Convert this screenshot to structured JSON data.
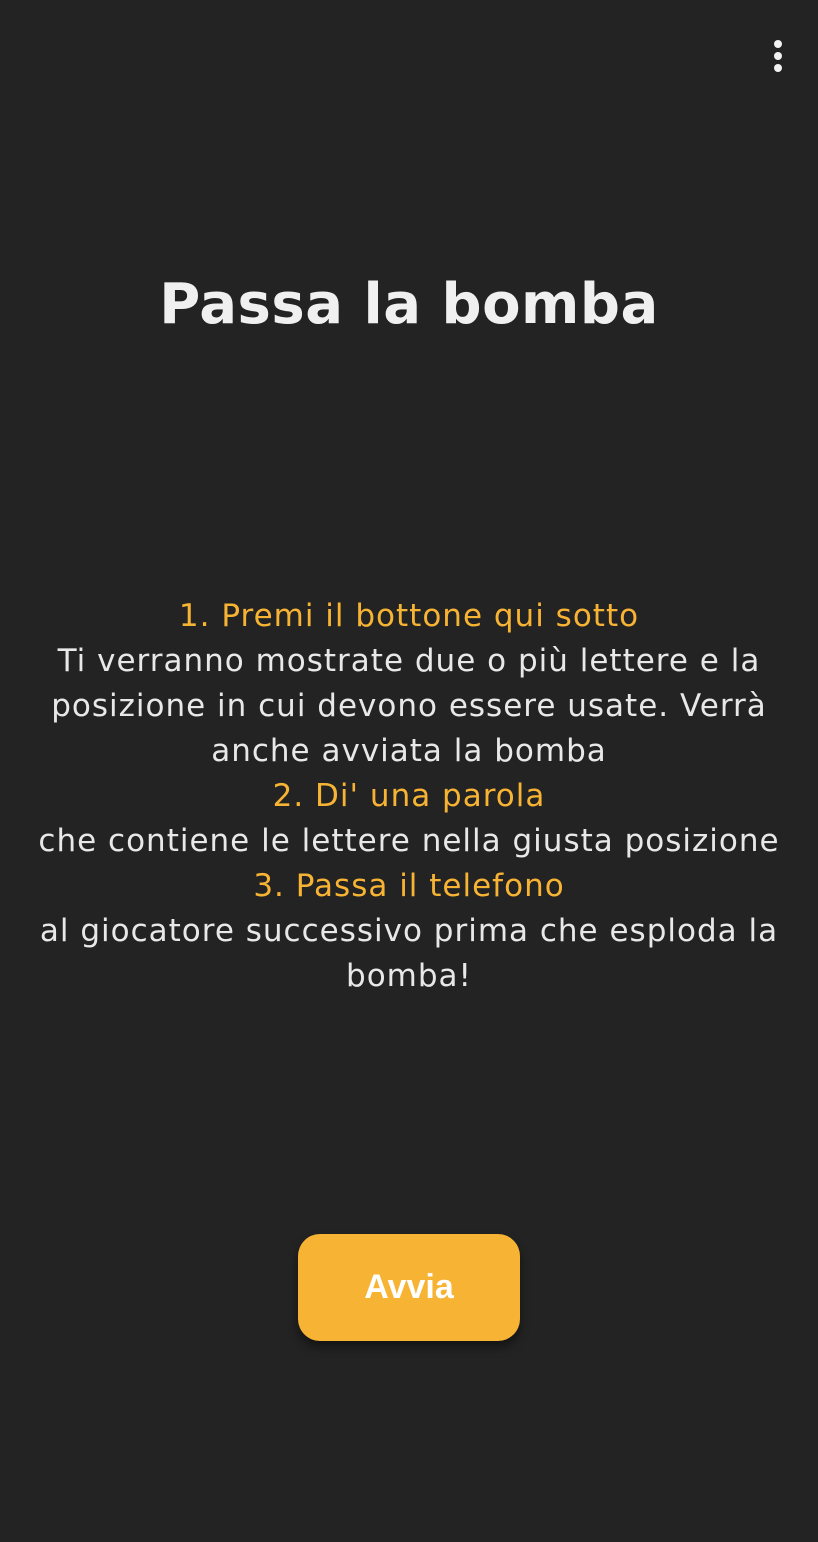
{
  "menu": {
    "icon": "more-vert-icon"
  },
  "title": "Passa la bomba",
  "instructions": [
    {
      "title": "1. Premi il bottone qui sotto",
      "description": "Ti verranno mostrate due o più lettere e la posizione in cui devono essere usate. Verrà anche avviata la bomba"
    },
    {
      "title": "2. Di' una parola",
      "description": "che contiene le lettere nella giusta posizione"
    },
    {
      "title": "3. Passa il telefono",
      "description": "al giocatore successivo prima che esploda la bomba!"
    }
  ],
  "start_button": {
    "label": "Avvia"
  },
  "colors": {
    "background": "#232323",
    "accent": "#f7b333",
    "text": "#e8e8e8"
  }
}
